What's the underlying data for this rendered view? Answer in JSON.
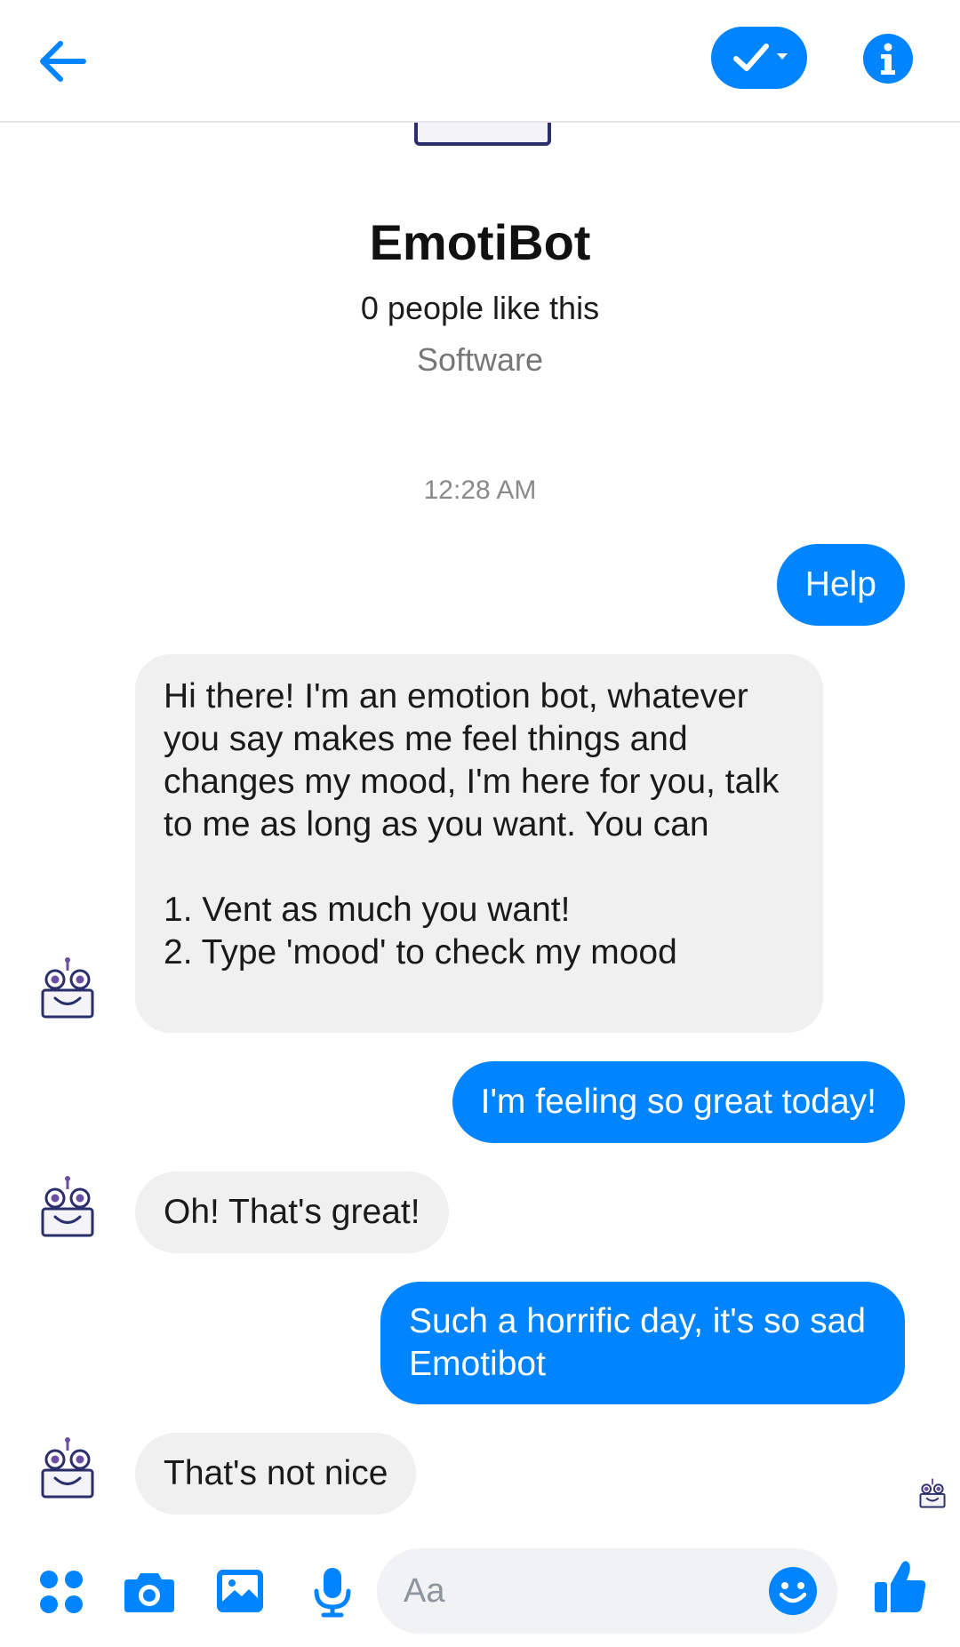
{
  "header": {
    "back_icon": "arrow-left-icon",
    "mark_icon": "checkmark-icon",
    "info_icon": "info-icon",
    "accent_color": "#0084ff"
  },
  "profile": {
    "name": "EmotiBot",
    "likes": "0 people like this",
    "category": "Software"
  },
  "conversation": {
    "timestamp": "12:28 AM",
    "messages": [
      {
        "sender": "me",
        "text": "Help"
      },
      {
        "sender": "bot",
        "text": "Hi there! I'm an emotion bot, whatever you say makes me feel things and changes my mood, I'm here for you, talk to me as long as you want. You can\n\n 1. Vent as much you want!\n 2. Type 'mood' to check my mood"
      },
      {
        "sender": "me",
        "text": "I'm feeling so great today!"
      },
      {
        "sender": "bot",
        "text": "Oh! That's great!"
      },
      {
        "sender": "me",
        "text": "Such a horrific day, it's so sad Emotibot"
      },
      {
        "sender": "bot",
        "text": "That's not nice"
      }
    ]
  },
  "composer": {
    "placeholder": "Aa",
    "icons": [
      "apps-icon",
      "camera-icon",
      "gallery-icon",
      "microphone-icon",
      "emoji-icon",
      "thumbs-up-icon"
    ]
  }
}
